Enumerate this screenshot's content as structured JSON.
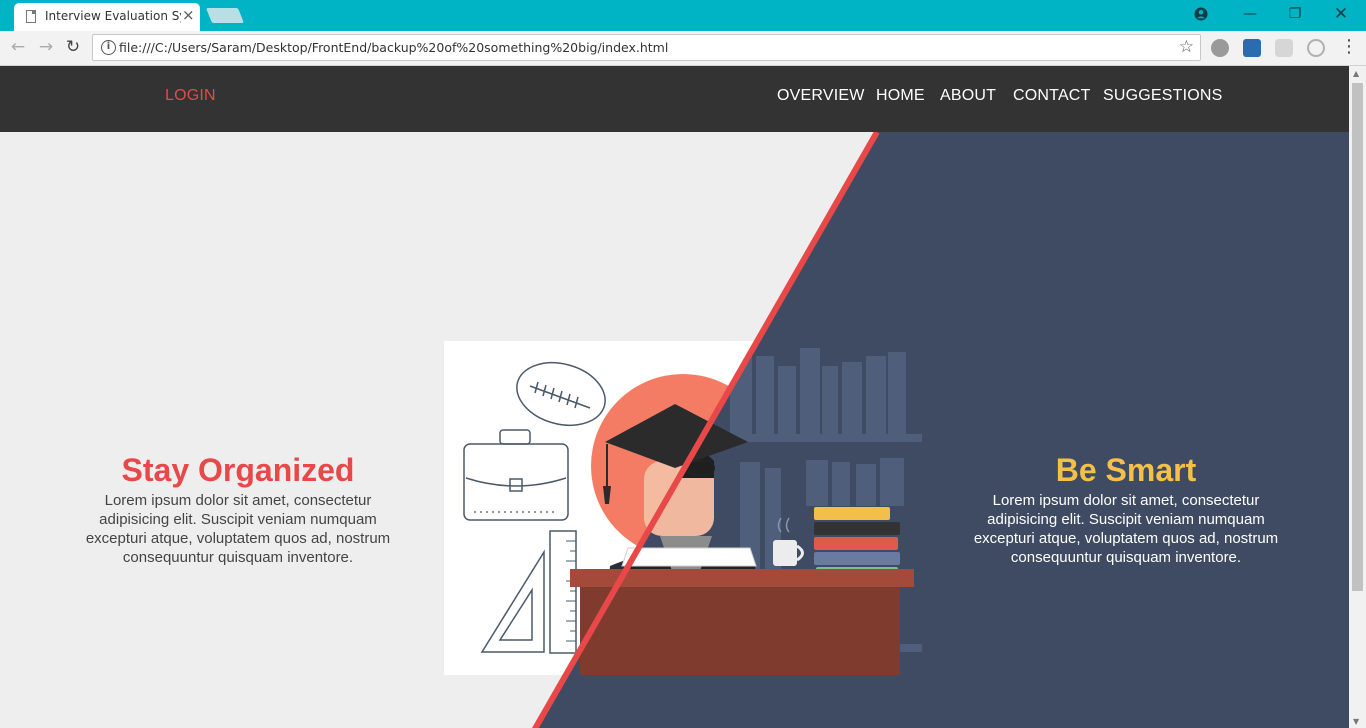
{
  "browser": {
    "tab_title": "Interview Evaluation System",
    "tab_close": "×",
    "url": "file:///C:/Users/Saram/Desktop/FrontEnd/backup%20of%20something%20big/index.html",
    "window_controls": {
      "minimize": "—",
      "restore": "❐",
      "close": "✕"
    },
    "nav": {
      "back": "←",
      "forward": "→",
      "reload": "↻"
    },
    "bookmark_star": "☆",
    "menu": "⋮"
  },
  "site_nav": {
    "login": "LOGIN",
    "links": [
      "OVERVIEW",
      "HOME",
      "ABOUT",
      "CONTACT",
      "SUGGESTIONS"
    ]
  },
  "panels": {
    "left": {
      "title": "Stay Organized",
      "text": "Lorem ipsum dolor sit amet, consectetur adipisicing elit. Suscipit veniam numquam excepturi atque, voluptatem quos ad, nostrum consequuntur quisquam inventore."
    },
    "right": {
      "title": "Be Smart",
      "text": "Lorem ipsum dolor sit amet, consectetur adipisicing elit. Suscipit veniam numquam excepturi atque, voluptatem quos ad, nostrum consequuntur quisquam inventore."
    }
  },
  "colors": {
    "tab_strip": "#00b3c5",
    "nav_bg": "#333333",
    "left_bg": "#eeeeee",
    "right_bg": "#3e4b63",
    "divider": "#e84848",
    "left_title": "#e84848",
    "right_title": "#f5c04a"
  }
}
